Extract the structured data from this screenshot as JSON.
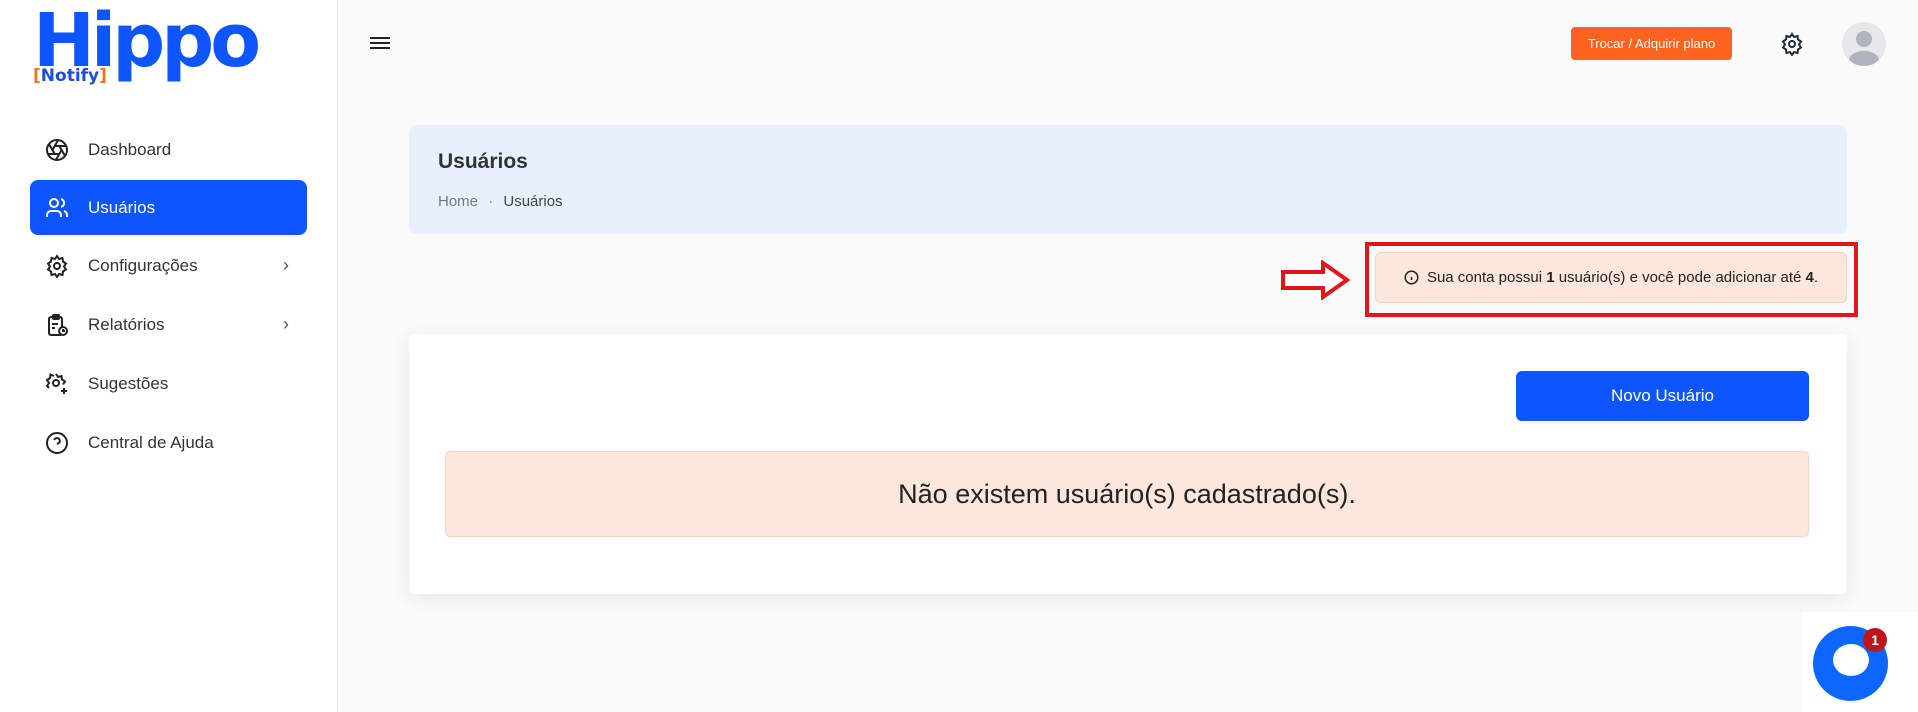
{
  "logo": {
    "title": "Hippo",
    "subtitle": "Notify"
  },
  "sidebar": {
    "items": [
      {
        "label": "Dashboard",
        "icon": "aperture-icon"
      },
      {
        "label": "Usuários",
        "icon": "users-icon",
        "active": true
      },
      {
        "label": "Configurações",
        "icon": "gear-icon",
        "submenu": true
      },
      {
        "label": "Relatórios",
        "icon": "report-icon",
        "submenu": true
      },
      {
        "label": "Sugestões",
        "icon": "gear-plus-icon"
      },
      {
        "label": "Central de Ajuda",
        "icon": "help-icon"
      }
    ]
  },
  "header": {
    "plan_button": "Trocar / Adquirir plano"
  },
  "page": {
    "title": "Usuários",
    "breadcrumb": [
      "Home",
      "Usuários"
    ]
  },
  "notice": {
    "prefix": "Sua conta possui ",
    "count": "1",
    "middle": " usuário(s) e você pode adicionar até ",
    "limit": "4",
    "suffix": "."
  },
  "main": {
    "new_user_button": "Novo Usuário",
    "empty_message": "Não existem usuário(s) cadastrado(s)."
  },
  "chat": {
    "unread": "1"
  },
  "colors": {
    "primary": "#0d55ff",
    "accent": "#ff621f",
    "highlight": "#e3141c"
  }
}
